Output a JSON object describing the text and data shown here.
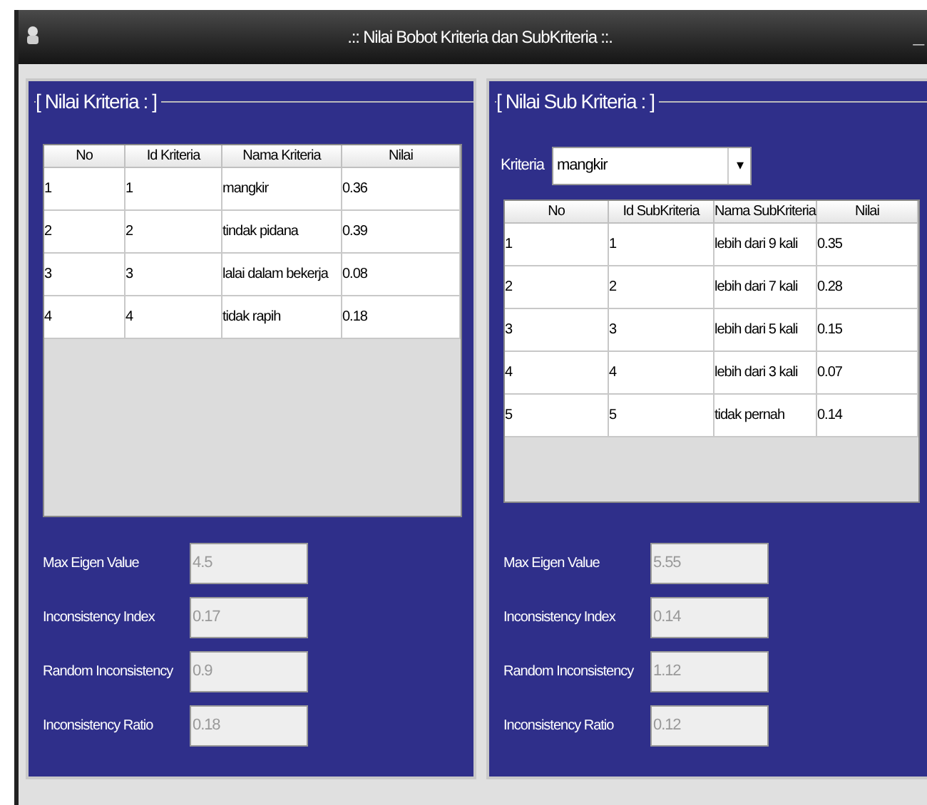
{
  "window": {
    "title": ".:: Nilai Bobot Kriteria dan SubKriteria ::.",
    "minimize": "_"
  },
  "panels": [
    {
      "title": "[ Nilai Kriteria : ]",
      "columns": [
        "No",
        "Id Kriteria",
        "Nama Kriteria",
        "Nilai"
      ],
      "rows": [
        [
          "1",
          "1",
          "mangkir",
          "0.36"
        ],
        [
          "2",
          "2",
          "tindak pidana",
          "0.39"
        ],
        [
          "3",
          "3",
          "lalai dalam bekerja",
          "0.08"
        ],
        [
          "4",
          "4",
          "tidak rapih",
          "0.18"
        ]
      ],
      "fields": [
        {
          "label": "Max Eigen Value",
          "value": "4.5",
          "disabled": true
        },
        {
          "label": "Inconsistency Index",
          "value": "0.17",
          "disabled": true
        },
        {
          "label": "Random Inconsistency",
          "value": "0.9",
          "disabled": true
        },
        {
          "label": "Inconsistency Ratio",
          "value": "0.18",
          "disabled": true
        }
      ]
    },
    {
      "title": "[ Nilai Sub Kriteria : ]",
      "filter": {
        "label": "Kriteria",
        "value": "mangkir",
        "arrow": "▾"
      },
      "columns": [
        "No",
        "Id SubKriteria",
        "Nama SubKriteria",
        "Nilai"
      ],
      "rows": [
        [
          "1",
          "1",
          "lebih dari 9 kali",
          "0.35"
        ],
        [
          "2",
          "2",
          "lebih dari 7 kali",
          "0.28"
        ],
        [
          "3",
          "3",
          "lebih dari 5 kali",
          "0.15"
        ],
        [
          "4",
          "4",
          "lebih dari 3 kali",
          "0.07"
        ],
        [
          "5",
          "5",
          "tidak pernah",
          "0.14"
        ]
      ],
      "fields": [
        {
          "label": "Max Eigen Value",
          "value": "5.55",
          "disabled": true
        },
        {
          "label": "Inconsistency Index",
          "value": "0.14",
          "disabled": true
        },
        {
          "label": "Random Inconsistency",
          "value": "1.12",
          "disabled": true
        },
        {
          "label": "Inconsistency Ratio",
          "value": "0.12",
          "disabled": true
        }
      ]
    }
  ]
}
